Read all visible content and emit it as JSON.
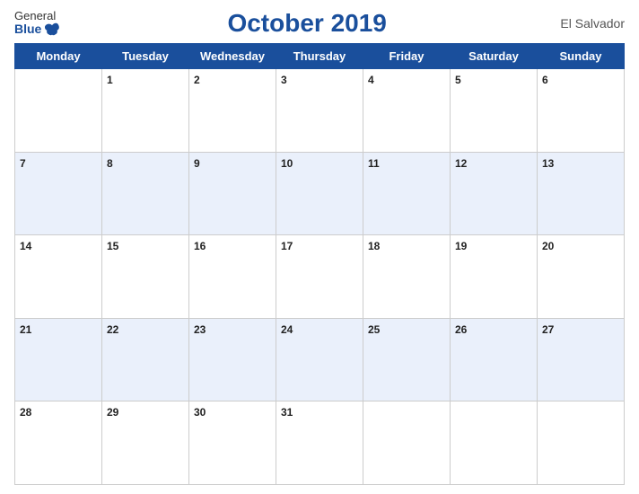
{
  "header": {
    "logo_general": "General",
    "logo_blue": "Blue",
    "title": "October 2019",
    "country": "El Salvador"
  },
  "days_of_week": [
    "Monday",
    "Tuesday",
    "Wednesday",
    "Thursday",
    "Friday",
    "Saturday",
    "Sunday"
  ],
  "weeks": [
    [
      null,
      "1",
      "2",
      "3",
      "4",
      "5",
      "6"
    ],
    [
      "7",
      "8",
      "9",
      "10",
      "11",
      "12",
      "13"
    ],
    [
      "14",
      "15",
      "16",
      "17",
      "18",
      "19",
      "20"
    ],
    [
      "21",
      "22",
      "23",
      "24",
      "25",
      "26",
      "27"
    ],
    [
      "28",
      "29",
      "30",
      "31",
      null,
      null,
      null
    ]
  ]
}
